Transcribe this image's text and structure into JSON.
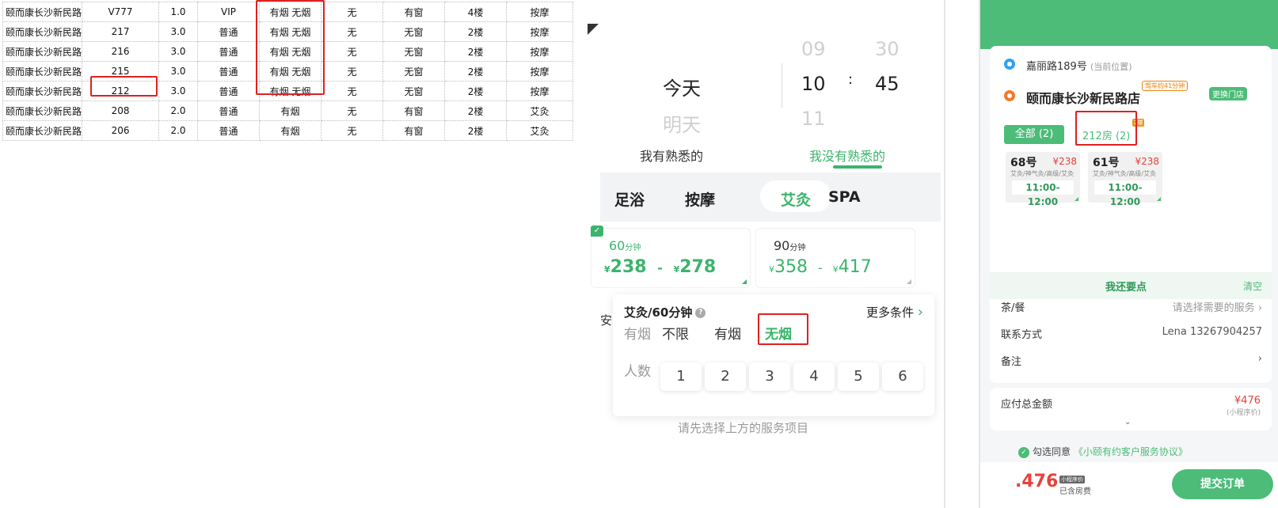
{
  "sheet": {
    "rows": [
      [
        "颐而康长沙新民路",
        "V777",
        "1.0",
        "VIP",
        "有烟 无烟",
        "无",
        "有窗",
        "4楼",
        "按摩"
      ],
      [
        "颐而康长沙新民路",
        "217",
        "3.0",
        "普通",
        "有烟 无烟",
        "无",
        "无窗",
        "2楼",
        "按摩"
      ],
      [
        "颐而康长沙新民路",
        "216",
        "3.0",
        "普通",
        "有烟 无烟",
        "无",
        "无窗",
        "2楼",
        "按摩"
      ],
      [
        "颐而康长沙新民路",
        "215",
        "3.0",
        "普通",
        "有烟 无烟",
        "无",
        "无窗",
        "2楼",
        "按摩"
      ],
      [
        "颐而康长沙新民路",
        "212",
        "3.0",
        "普通",
        "有烟 无烟",
        "无",
        "无窗",
        "2楼",
        "按摩"
      ],
      [
        "颐而康长沙新民路",
        "208",
        "2.0",
        "普通",
        "有烟",
        "无",
        "有窗",
        "2楼",
        "艾灸"
      ],
      [
        "颐而康长沙新民路",
        "206",
        "2.0",
        "普通",
        "有烟",
        "无",
        "有窗",
        "2楼",
        "艾灸"
      ]
    ]
  },
  "picker": {
    "day_today": "今天",
    "day_tomorrow": "明天",
    "hour_prev": "09",
    "hour_sel": "10",
    "hour_next": "11",
    "colon": ":",
    "min_prev": "30",
    "min_sel": "45",
    "tab_familiar": "我有熟悉的",
    "tab_unfamiliar": "我没有熟悉的",
    "categories": [
      "足浴",
      "按摩",
      "艾灸",
      "SPA"
    ],
    "card1": {
      "duration": "60",
      "unit": "分钟",
      "yen": "¥",
      "low": "238",
      "dash": "-",
      "high": "278"
    },
    "card2": {
      "duration": "90",
      "unit": "分钟",
      "yen": "¥",
      "low": "358",
      "dash": "-",
      "high": "417"
    },
    "check_icon": "✓",
    "filter": {
      "title": "艾灸/60分钟",
      "help_icon": "?",
      "more": "更多条件",
      "more_icon": "›",
      "smoke_label": "有烟",
      "smoke_options": [
        "不限",
        "有烟",
        "无烟"
      ],
      "people_label": "人数",
      "people_options": [
        "1",
        "2",
        "3",
        "4",
        "5",
        "6"
      ]
    },
    "behind_char": "安",
    "hint": "请先选择上方的服务项目"
  },
  "order": {
    "addr_current": "嘉丽路189号",
    "addr_current_tag": "(当前位置)",
    "store_name": "颐而康长沙新民路店",
    "distance_tag": "驾车约41分钟",
    "switch_store": "更换门店",
    "tab_all": "全部 (2)",
    "tab_room": "212房 (2)",
    "floor_tag": "2楼",
    "techs": [
      {
        "name": "68号",
        "price": "¥238",
        "desc": "艾灸/神气灸/高级/艾灸",
        "time": "11:00-12:00"
      },
      {
        "name": "61号",
        "price": "¥238",
        "desc": "艾灸/神气灸/高级/艾灸",
        "time": "11:00-12:00"
      }
    ],
    "more_order": "我还要点",
    "clear": "清空",
    "tea_label": "茶/餐",
    "tea_value": "请选择需要的服务",
    "contact_label": "联系方式",
    "contact_value": "Lena 13267904257",
    "note_label": "备注",
    "chevron": "›",
    "total_label": "应付总金额",
    "total_value": "¥476",
    "total_sub": "(小程序价)",
    "expand_icon": "⌄",
    "agree_check": "✓",
    "agree_text": "勾选同意",
    "agree_link": "《小颐有约客户服务协议》",
    "bottom_price": ".476",
    "bottom_tag": "小程序价",
    "bottom_inc": "已含房费",
    "submit": "提交订单"
  },
  "colors": {
    "accent": "#4cbc78",
    "price_red": "#e8413d",
    "highlight_red": "#e02020"
  }
}
